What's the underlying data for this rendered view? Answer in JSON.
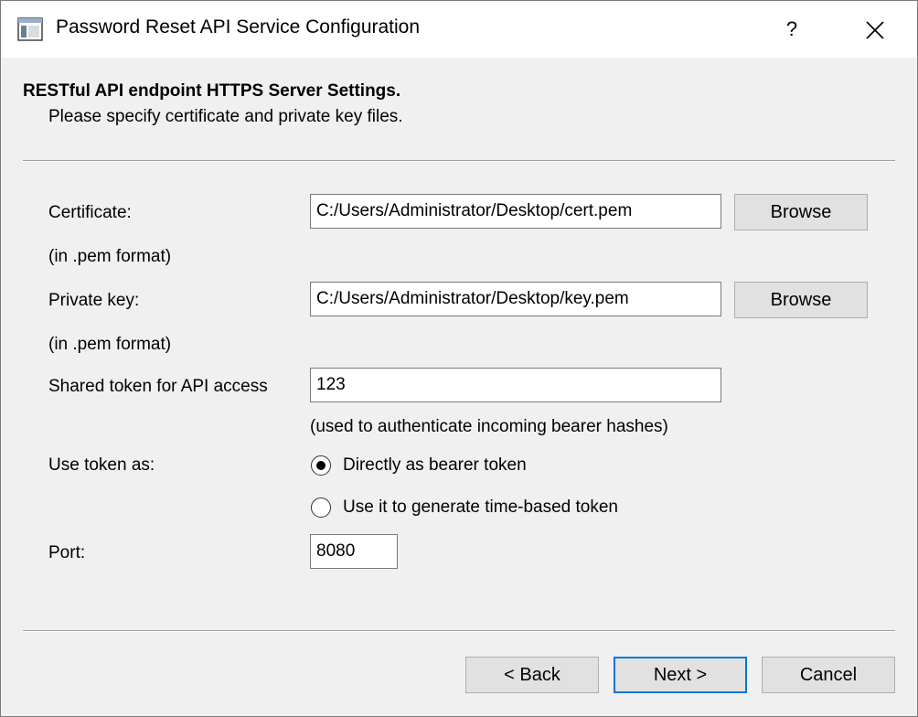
{
  "window": {
    "title": "Password Reset API Service Configuration",
    "help_label": "?",
    "icons": {
      "app": "window-app-icon",
      "close": "close-icon"
    }
  },
  "header": {
    "title": "RESTful API endpoint HTTPS Server Settings.",
    "subtitle": "Please specify certificate and private key files."
  },
  "form": {
    "certificate": {
      "label": "Certificate:",
      "hint": "(in .pem format)",
      "value": "C:/Users/Administrator/Desktop/cert.pem",
      "browse_label": "Browse"
    },
    "private_key": {
      "label": "Private key:",
      "hint": "(in .pem format)",
      "value": "C:/Users/Administrator/Desktop/key.pem",
      "browse_label": "Browse"
    },
    "token": {
      "label": "Shared token for API access",
      "value": "123",
      "hint": "(used to authenticate incoming bearer hashes)"
    },
    "use_token": {
      "label": "Use token as:",
      "options": [
        {
          "label": "Directly as bearer token",
          "selected": true
        },
        {
          "label": "Use it to generate time-based token",
          "selected": false
        }
      ]
    },
    "port": {
      "label": "Port:",
      "value": "8080"
    }
  },
  "footer": {
    "back_label": "< Back",
    "next_label": "Next >",
    "cancel_label": "Cancel"
  }
}
